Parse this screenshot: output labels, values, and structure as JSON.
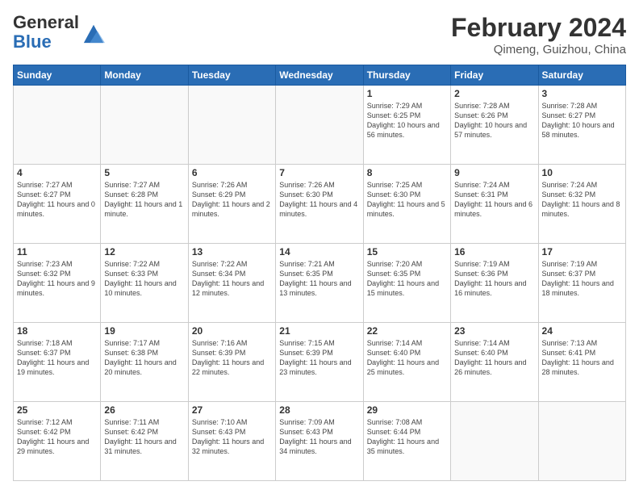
{
  "header": {
    "logo_general": "General",
    "logo_blue": "Blue",
    "month_year": "February 2024",
    "location": "Qimeng, Guizhou, China"
  },
  "weekdays": [
    "Sunday",
    "Monday",
    "Tuesday",
    "Wednesday",
    "Thursday",
    "Friday",
    "Saturday"
  ],
  "weeks": [
    [
      {
        "day": "",
        "info": ""
      },
      {
        "day": "",
        "info": ""
      },
      {
        "day": "",
        "info": ""
      },
      {
        "day": "",
        "info": ""
      },
      {
        "day": "1",
        "info": "Sunrise: 7:29 AM\nSunset: 6:25 PM\nDaylight: 10 hours\nand 56 minutes."
      },
      {
        "day": "2",
        "info": "Sunrise: 7:28 AM\nSunset: 6:26 PM\nDaylight: 10 hours\nand 57 minutes."
      },
      {
        "day": "3",
        "info": "Sunrise: 7:28 AM\nSunset: 6:27 PM\nDaylight: 10 hours\nand 58 minutes."
      }
    ],
    [
      {
        "day": "4",
        "info": "Sunrise: 7:27 AM\nSunset: 6:27 PM\nDaylight: 11 hours\nand 0 minutes."
      },
      {
        "day": "5",
        "info": "Sunrise: 7:27 AM\nSunset: 6:28 PM\nDaylight: 11 hours\nand 1 minute."
      },
      {
        "day": "6",
        "info": "Sunrise: 7:26 AM\nSunset: 6:29 PM\nDaylight: 11 hours\nand 2 minutes."
      },
      {
        "day": "7",
        "info": "Sunrise: 7:26 AM\nSunset: 6:30 PM\nDaylight: 11 hours\nand 4 minutes."
      },
      {
        "day": "8",
        "info": "Sunrise: 7:25 AM\nSunset: 6:30 PM\nDaylight: 11 hours\nand 5 minutes."
      },
      {
        "day": "9",
        "info": "Sunrise: 7:24 AM\nSunset: 6:31 PM\nDaylight: 11 hours\nand 6 minutes."
      },
      {
        "day": "10",
        "info": "Sunrise: 7:24 AM\nSunset: 6:32 PM\nDaylight: 11 hours\nand 8 minutes."
      }
    ],
    [
      {
        "day": "11",
        "info": "Sunrise: 7:23 AM\nSunset: 6:32 PM\nDaylight: 11 hours\nand 9 minutes."
      },
      {
        "day": "12",
        "info": "Sunrise: 7:22 AM\nSunset: 6:33 PM\nDaylight: 11 hours\nand 10 minutes."
      },
      {
        "day": "13",
        "info": "Sunrise: 7:22 AM\nSunset: 6:34 PM\nDaylight: 11 hours\nand 12 minutes."
      },
      {
        "day": "14",
        "info": "Sunrise: 7:21 AM\nSunset: 6:35 PM\nDaylight: 11 hours\nand 13 minutes."
      },
      {
        "day": "15",
        "info": "Sunrise: 7:20 AM\nSunset: 6:35 PM\nDaylight: 11 hours\nand 15 minutes."
      },
      {
        "day": "16",
        "info": "Sunrise: 7:19 AM\nSunset: 6:36 PM\nDaylight: 11 hours\nand 16 minutes."
      },
      {
        "day": "17",
        "info": "Sunrise: 7:19 AM\nSunset: 6:37 PM\nDaylight: 11 hours\nand 18 minutes."
      }
    ],
    [
      {
        "day": "18",
        "info": "Sunrise: 7:18 AM\nSunset: 6:37 PM\nDaylight: 11 hours\nand 19 minutes."
      },
      {
        "day": "19",
        "info": "Sunrise: 7:17 AM\nSunset: 6:38 PM\nDaylight: 11 hours\nand 20 minutes."
      },
      {
        "day": "20",
        "info": "Sunrise: 7:16 AM\nSunset: 6:39 PM\nDaylight: 11 hours\nand 22 minutes."
      },
      {
        "day": "21",
        "info": "Sunrise: 7:15 AM\nSunset: 6:39 PM\nDaylight: 11 hours\nand 23 minutes."
      },
      {
        "day": "22",
        "info": "Sunrise: 7:14 AM\nSunset: 6:40 PM\nDaylight: 11 hours\nand 25 minutes."
      },
      {
        "day": "23",
        "info": "Sunrise: 7:14 AM\nSunset: 6:40 PM\nDaylight: 11 hours\nand 26 minutes."
      },
      {
        "day": "24",
        "info": "Sunrise: 7:13 AM\nSunset: 6:41 PM\nDaylight: 11 hours\nand 28 minutes."
      }
    ],
    [
      {
        "day": "25",
        "info": "Sunrise: 7:12 AM\nSunset: 6:42 PM\nDaylight: 11 hours\nand 29 minutes."
      },
      {
        "day": "26",
        "info": "Sunrise: 7:11 AM\nSunset: 6:42 PM\nDaylight: 11 hours\nand 31 minutes."
      },
      {
        "day": "27",
        "info": "Sunrise: 7:10 AM\nSunset: 6:43 PM\nDaylight: 11 hours\nand 32 minutes."
      },
      {
        "day": "28",
        "info": "Sunrise: 7:09 AM\nSunset: 6:43 PM\nDaylight: 11 hours\nand 34 minutes."
      },
      {
        "day": "29",
        "info": "Sunrise: 7:08 AM\nSunset: 6:44 PM\nDaylight: 11 hours\nand 35 minutes."
      },
      {
        "day": "",
        "info": ""
      },
      {
        "day": "",
        "info": ""
      }
    ]
  ]
}
